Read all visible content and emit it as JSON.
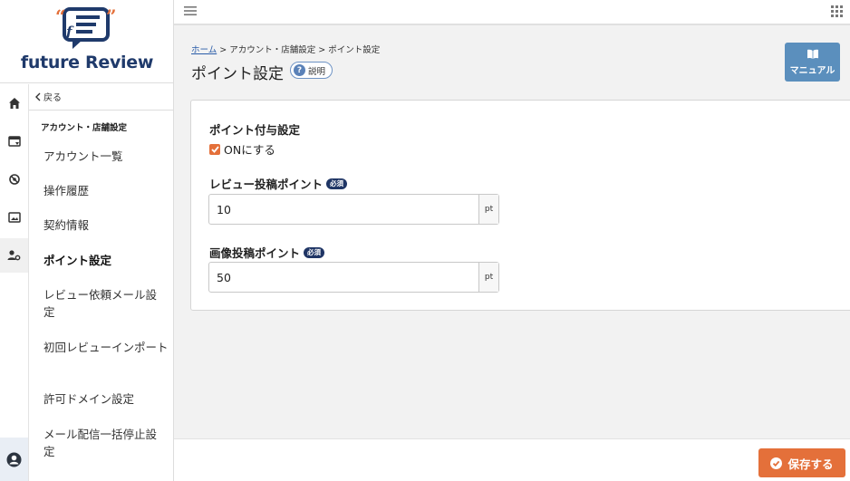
{
  "brand": {
    "name": "future Review"
  },
  "sidebar": {
    "back_label": "戻る",
    "section_title": "アカウント・店舗設定",
    "items": [
      {
        "label": "アカウント一覧"
      },
      {
        "label": "操作履歴"
      },
      {
        "label": "契約情報"
      },
      {
        "label": "ポイント設定",
        "active": true
      },
      {
        "label": "レビュー依頼メール設定"
      },
      {
        "label": "初回レビューインポート"
      },
      {
        "label": "許可ドメイン設定"
      },
      {
        "label": "メール配信一括停止設定"
      }
    ]
  },
  "breadcrumb": {
    "home": "ホーム",
    "sep": ">",
    "level1": "アカウント・店舗設定",
    "current": "ポイント設定"
  },
  "page": {
    "title": "ポイント設定",
    "help_label": "説明"
  },
  "manual_button": {
    "label": "マニュアル"
  },
  "form": {
    "grant": {
      "label": "ポイント付与設定",
      "checkbox_label": "ONにする",
      "checked": true
    },
    "review_points": {
      "label": "レビュー投稿ポイント",
      "required": "必須",
      "value": "10",
      "unit": "pt"
    },
    "image_points": {
      "label": "画像投稿ポイント",
      "required": "必須",
      "value": "50",
      "unit": "pt"
    }
  },
  "footer": {
    "save_label": "保存する"
  },
  "colors": {
    "accent": "#e4703a",
    "brand_navy": "#1f3a6b",
    "manual_blue": "#5b8fbd"
  }
}
